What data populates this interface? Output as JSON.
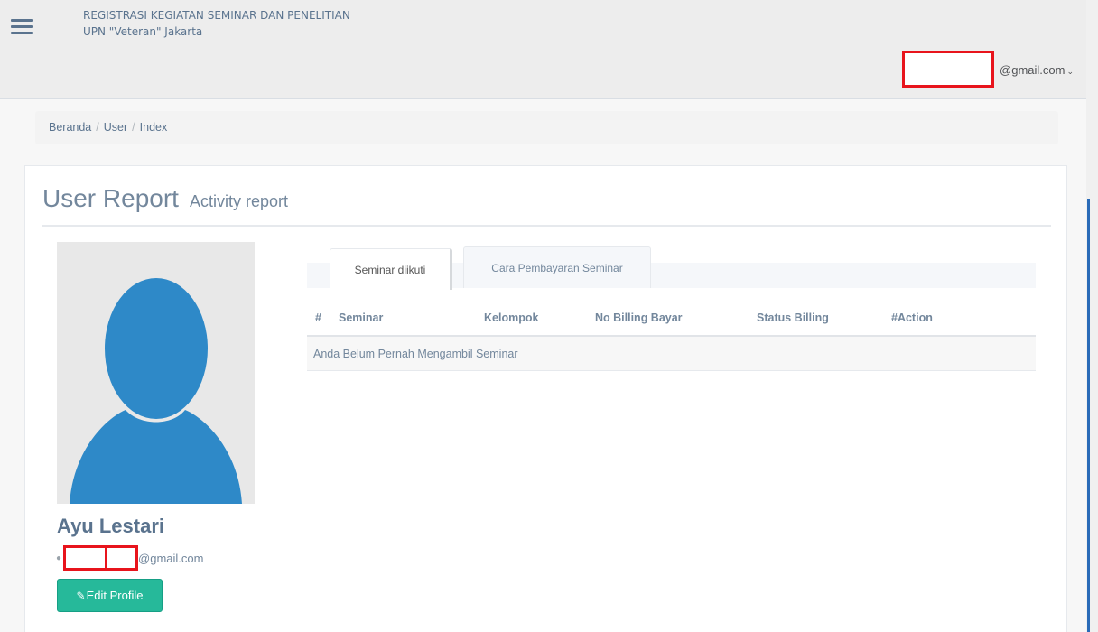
{
  "header": {
    "title_line1": "REGISTRASI KEGIATAN SEMINAR DAN PENELITIAN",
    "title_line2": "UPN \"Veteran\" Jakarta",
    "user_email_suffix": "@gmail.com",
    "menu_icon": "hamburger-icon",
    "chevron_icon": "chevron-down-icon"
  },
  "breadcrumb": {
    "items": [
      "Beranda",
      "User",
      "Index"
    ],
    "separator": "/"
  },
  "panel": {
    "title": "User Report",
    "subtitle": "Activity report"
  },
  "profile": {
    "name": "Ayu Lestari",
    "email_suffix": "@gmail.com",
    "edit_button": "Edit Profile",
    "edit_icon": "edit-icon",
    "avatar_icon": "default-avatar-icon"
  },
  "tabs": [
    {
      "label": "Seminar diikuti",
      "active": true
    },
    {
      "label": "Cara Pembayaran Seminar",
      "active": false
    }
  ],
  "table": {
    "columns": [
      "#",
      "Seminar",
      "Kelompok",
      "No Billing Bayar",
      "Status Billing",
      "#Action"
    ],
    "empty_message": "Anda Belum Pernah Mengambil Seminar"
  },
  "colors": {
    "accent_green": "#26b99a",
    "redaction_red": "#e8141c",
    "avatar_blue": "#2e89c8",
    "heading_text": "#5a738e"
  }
}
